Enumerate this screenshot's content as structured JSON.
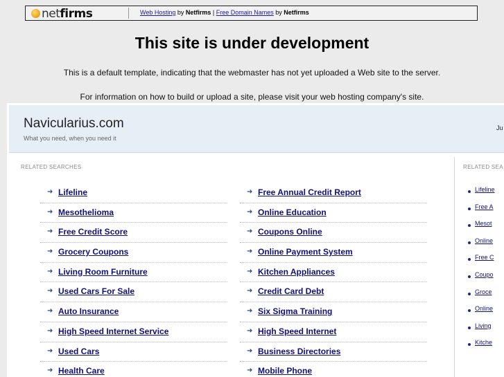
{
  "banner": {
    "logo_net": "net",
    "logo_firms": "firms",
    "web_hosting": "Web Hosting",
    "by1": " by ",
    "netfirms1": "Netfirms",
    "pipe": " | ",
    "free_domains": "Free Domain Names",
    "by2": " by ",
    "netfirms2": "Netfirms"
  },
  "heading": "This site is under development",
  "message1": "This is a default template, indicating that the webmaster has not yet uploaded a Web site to the server.",
  "message2": "For information on how to build or upload a site, please visit your web hosting company's site.",
  "parked": {
    "site_name": "Navicularius.com",
    "tagline": "What you need, when you need it",
    "date_fragment": "Ju",
    "related_title": "RELATED SEARCHES",
    "related_title_side": "RELATED SEA",
    "col1": [
      "Lifeline",
      "Mesothelioma",
      "Free Credit Score",
      "Grocery Coupons",
      "Living Room Furniture",
      "Used Cars For Sale",
      "Auto Insurance",
      "High Speed Internet Service",
      "Used Cars",
      "Health Care"
    ],
    "col2": [
      "Free Annual Credit Report",
      "Online Education",
      "Coupons Online",
      "Online Payment System",
      "Kitchen Appliances",
      "Credit Card Debt",
      "Six Sigma Training",
      "High Speed Internet",
      "Business Directories",
      "Mobile Phone"
    ],
    "side": [
      "Lifeline",
      "Free A",
      "Mesot",
      "Online",
      "Free C",
      "Coupo",
      "Groce",
      "Online",
      "Living",
      "Kitche"
    ]
  },
  "icons": {
    "arrow": "arrow-right-icon",
    "bullet": "bullet-icon",
    "logo": "netfirms-logo"
  }
}
